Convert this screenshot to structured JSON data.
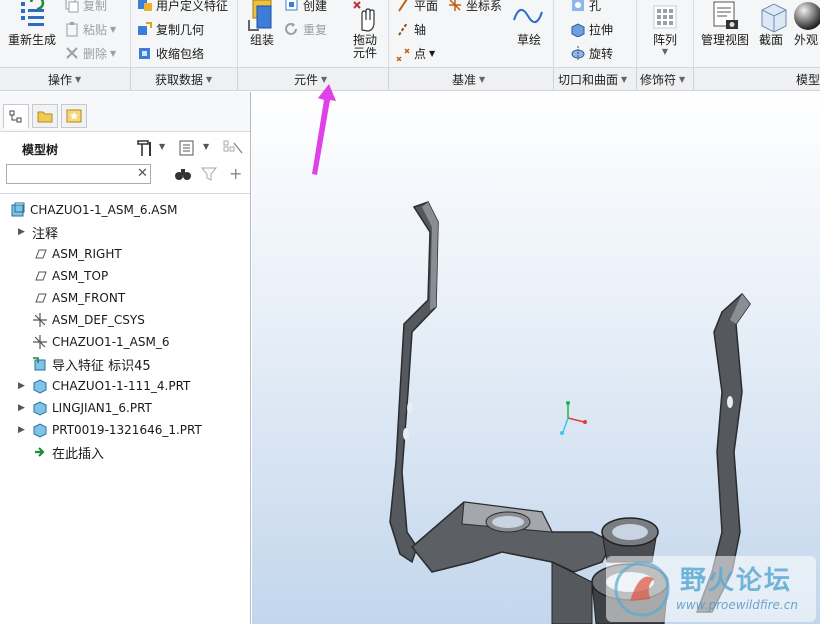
{
  "ribbon": {
    "operations": {
      "regenerate": "重新生成",
      "copy": "复制",
      "paste": "粘贴",
      "delete": "删除"
    },
    "get_data": {
      "udf": "用户定义特征",
      "copy_geometry": "复制几何",
      "shrinkwrap": "收缩包络"
    },
    "component": {
      "assemble": "组装",
      "create": "创建",
      "repeat": "重复"
    },
    "drag": {
      "label_line1": "拖动",
      "label_line2": "元件"
    },
    "datum": {
      "plane": "平面",
      "csys": "坐标系",
      "axis": "轴",
      "point": "点",
      "sketch": "草绘"
    },
    "cut_surface": {
      "hole": "孔",
      "extrude": "拉伸",
      "revolve": "旋转"
    },
    "modifiers": {
      "pattern": "阵列"
    },
    "model_display": {
      "manage_views": "管理视图",
      "section": "截面",
      "appearance": "外观"
    },
    "group_labels": {
      "operations": "操作",
      "get_data": "获取数据",
      "component": "元件",
      "datum": "基准",
      "cut_surface": "切口和曲面",
      "modifiers": "修饰符",
      "model_display": "模型"
    }
  },
  "panel": {
    "tree_title": "模型树",
    "search_value": "",
    "tree": [
      {
        "label": "CHAZUO1-1_ASM_6.ASM",
        "icon": "assembly-icon",
        "expander": false,
        "indent": 0
      },
      {
        "label": "注释",
        "icon": "",
        "expander": true,
        "indent": 1
      },
      {
        "label": "ASM_RIGHT",
        "icon": "datum-plane-icon",
        "expander": false,
        "indent": 1
      },
      {
        "label": "ASM_TOP",
        "icon": "datum-plane-icon",
        "expander": false,
        "indent": 1
      },
      {
        "label": "ASM_FRONT",
        "icon": "datum-plane-icon",
        "expander": false,
        "indent": 1
      },
      {
        "label": "ASM_DEF_CSYS",
        "icon": "csys-icon",
        "expander": false,
        "indent": 1
      },
      {
        "label": "CHAZUO1-1_ASM_6",
        "icon": "csys-icon",
        "expander": false,
        "indent": 1
      },
      {
        "label": "导入特征 标识45",
        "icon": "import-feature-icon",
        "expander": false,
        "indent": 1
      },
      {
        "label": "CHAZUO1-1-111_4.PRT",
        "icon": "part-icon",
        "expander": true,
        "indent": 1
      },
      {
        "label": "LINGJIAN1_6.PRT",
        "icon": "part-icon",
        "expander": true,
        "indent": 1
      },
      {
        "label": "PRT0019-1321646_1.PRT",
        "icon": "part-icon",
        "expander": true,
        "indent": 1
      },
      {
        "label": "在此插入",
        "icon": "insert-here-icon",
        "expander": false,
        "indent": 1
      }
    ]
  },
  "watermark": {
    "title": "野火论坛",
    "url": "www.proewildfire.cn"
  },
  "colors": {
    "ribbon_bg": "#f5f6f7",
    "accent_arrow": "#e040e8",
    "part_fill": "#5a5d62",
    "viewport_bottom": "#c3d6ec"
  }
}
